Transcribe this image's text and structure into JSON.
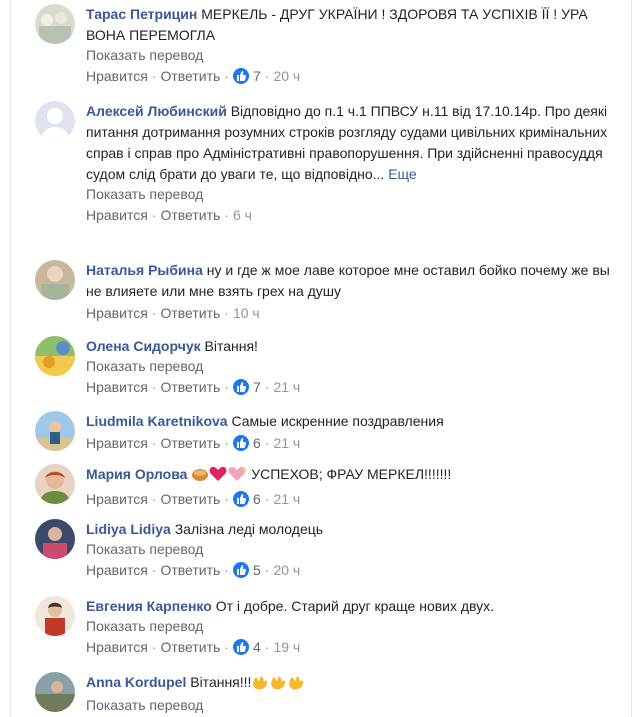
{
  "colors": {
    "name": "#385898",
    "meta": "#616770",
    "like": "#1877f2"
  },
  "comments": [
    {
      "author": "Тарас Петрицин",
      "text": "МЕРКЕЛЬ - ДРУГ УКРАЇНИ ! ЗДОРОВЯ ТА УСПІХІВ ЇЇ ! УРА ВОНА ПЕРЕМОГЛА",
      "translate": "Показать перевод",
      "like": "Нравится",
      "reply": "Ответить",
      "likes": "7",
      "time": "20 ч"
    },
    {
      "author": "Алексей Любинский",
      "text": "Відповідно до п.1 ч.1 ППВСУ н.11 від 17.10.14р. Про деякі питання дотримання розумних строків розгляду судами цивільних кримінальних справ і справ про Адміністративні правопорушення. При здійсненні правосуддя судом слід брати до уваги те, що відповідно...",
      "more": "Еще",
      "translate": "Показать перевод",
      "like": "Нравится",
      "reply": "Ответить",
      "time": "6 ч"
    },
    {
      "author": "Наталья Рыбина",
      "text": "ну и где ж мое лаве которое мне оставил бойко почему же вы не влияете или мне взять грех на душу",
      "like": "Нравится",
      "reply": "Ответить",
      "time": "10 ч"
    },
    {
      "author": "Олена Сидорчук",
      "text": "Вітання!",
      "translate": "Показать перевод",
      "like": "Нравится",
      "reply": "Ответить",
      "likes": "7",
      "time": "21 ч"
    },
    {
      "author": "Liudmila Karetnikova",
      "text": "Самые искренние поздравления",
      "like": "Нравится",
      "reply": "Ответить",
      "likes": "6",
      "time": "21 ч"
    },
    {
      "author": "Мария Орлова",
      "text": "УСПЕХОВ; ФРАУ МЕРКЕЛ!!!!!!!",
      "like": "Нравится",
      "reply": "Ответить",
      "likes": "6",
      "time": "21 ч"
    },
    {
      "author": "Lidiya Lidiya",
      "text": "Залізна леді молодець",
      "translate": "Показать перевод",
      "like": "Нравится",
      "reply": "Ответить",
      "likes": "5",
      "time": "20 ч"
    },
    {
      "author": "Евгения Карпенко",
      "text": "От і добре. Старий друг краще нових двух.",
      "translate": "Показать перевод",
      "like": "Нравится",
      "reply": "Ответить",
      "likes": "4",
      "time": "19 ч"
    },
    {
      "author": "Anna Kordupel",
      "text": "Вітання!!!",
      "translate": "Показать перевод"
    }
  ]
}
